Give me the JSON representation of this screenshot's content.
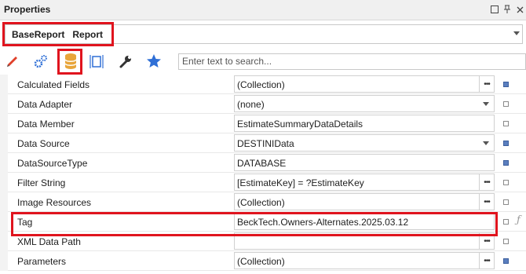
{
  "window": {
    "title": "Properties"
  },
  "object_selector": {
    "value": "BaseReport   Report"
  },
  "toolbar": {
    "tools": [
      {
        "name": "appearance-icon"
      },
      {
        "name": "behavior-icon"
      },
      {
        "name": "data-icon",
        "selected": true
      },
      {
        "name": "layout-icon"
      },
      {
        "name": "wrench-icon"
      },
      {
        "name": "favorites-star-icon"
      }
    ],
    "search_placeholder": "Enter text to search..."
  },
  "properties": [
    {
      "label": "Calculated Fields",
      "value": "(Collection)",
      "editor": "ellipsis",
      "marker": "bound"
    },
    {
      "label": "Data Adapter",
      "value": "(none)",
      "editor": "dropdown",
      "marker": "default"
    },
    {
      "label": "Data Member",
      "value": "EstimateSummaryDataDetails",
      "editor": "none",
      "marker": "default"
    },
    {
      "label": "Data Source",
      "value": "DESTINIData",
      "editor": "dropdown",
      "marker": "bound"
    },
    {
      "label": "DataSourceType",
      "value": "DATABASE",
      "editor": "none",
      "marker": "bound"
    },
    {
      "label": "Filter String",
      "value": "[EstimateKey] = ?EstimateKey",
      "editor": "ellipsis",
      "marker": "default"
    },
    {
      "label": "Image Resources",
      "value": "(Collection)",
      "editor": "ellipsis",
      "marker": "default"
    },
    {
      "label": "Tag",
      "value": "BeckTech.Owners-Alternates.2025.03.12",
      "editor": "none",
      "marker": "default",
      "expression": true
    },
    {
      "label": "XML Data Path",
      "value": "",
      "editor": "ellipsis",
      "marker": "default"
    },
    {
      "label": "Parameters",
      "value": "(Collection)",
      "editor": "ellipsis",
      "marker": "bound"
    }
  ],
  "colors": {
    "highlight": "#e0141e",
    "bound_marker": "#5b7fbf",
    "star": "#2f6fd6",
    "data_icon": "#e8a53a"
  }
}
